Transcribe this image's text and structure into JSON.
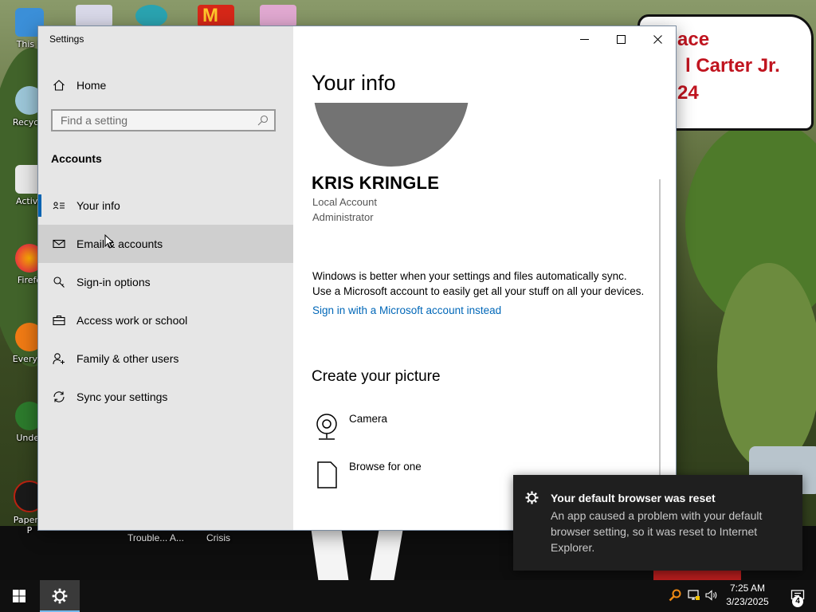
{
  "window": {
    "title": "Settings"
  },
  "nav": {
    "home_label": "Home",
    "search_placeholder": "Find a setting",
    "section_heading": "Accounts",
    "items": [
      {
        "label": "Your info",
        "icon": "contact-card-icon"
      },
      {
        "label": "Email & accounts",
        "icon": "mail-icon"
      },
      {
        "label": "Sign-in options",
        "icon": "key-icon"
      },
      {
        "label": "Access work or school",
        "icon": "briefcase-icon"
      },
      {
        "label": "Family & other users",
        "icon": "person-add-icon"
      },
      {
        "label": "Sync your settings",
        "icon": "sync-icon"
      }
    ],
    "selected_index": 0,
    "hover_index": 1
  },
  "content": {
    "title": "Your info",
    "user_name": "KRIS KRINGLE",
    "account_type": "Local Account",
    "role": "Administrator",
    "sync_line1": "Windows is better when your settings and files automatically sync.",
    "sync_line2": "Use a Microsoft account to easily get all your stuff on all your devices.",
    "ms_link": "Sign in with a Microsoft account instead",
    "picture_heading": "Create your picture",
    "camera_label": "Camera",
    "browse_label": "Browse for one"
  },
  "toast": {
    "title": "Your default browser was reset",
    "body": "An app caused a problem with your default browser setting, so it was reset to Internet Explorer."
  },
  "desktop": {
    "icons": [
      "This P",
      "Recycle",
      "Activa",
      "Firefo",
      "Everyth",
      "Under",
      "Papers, P"
    ],
    "sign_lines": [
      "ace",
      "l Carter Jr.",
      "24"
    ],
    "labels": [
      "Trouble... A...",
      "Crisis"
    ]
  },
  "taskbar": {
    "time": "7:25 AM",
    "date": "3/23/2025",
    "notification_count": "4"
  },
  "colors": {
    "accent": "#0063b1",
    "link": "#0067b8",
    "nav_bg": "#e6e6e6",
    "toast_bg": "#1f1f1f",
    "taskbar_bg": "#101010"
  }
}
